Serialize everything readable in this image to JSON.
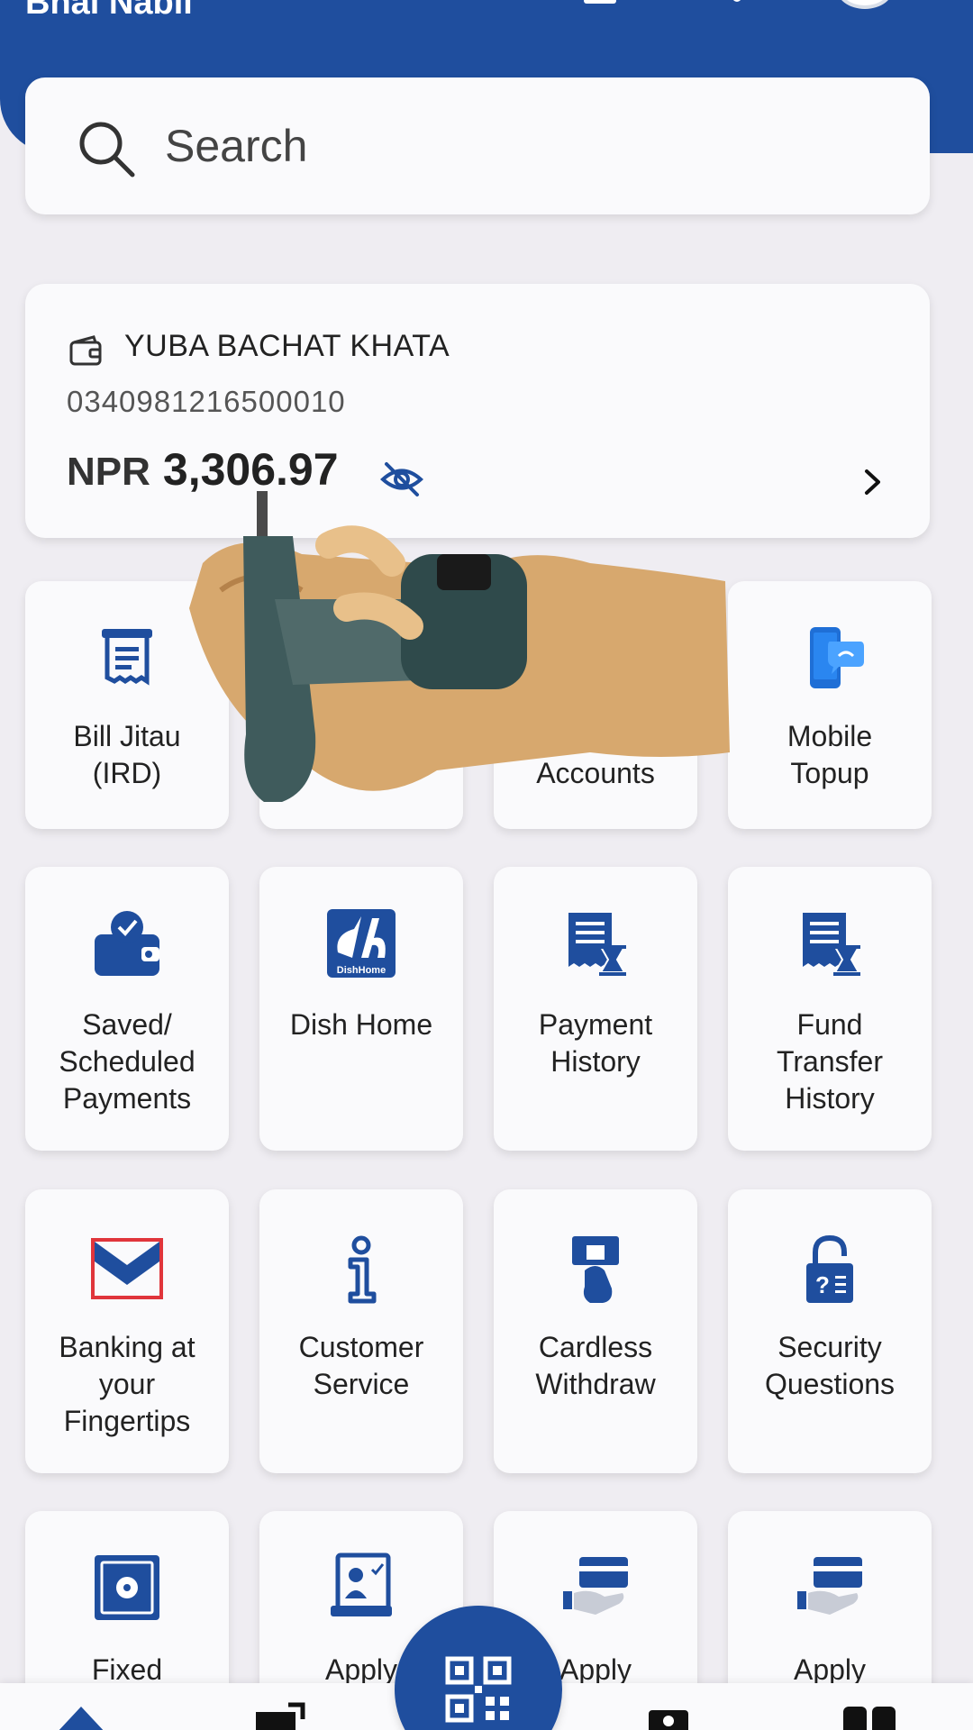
{
  "header": {
    "title": "Bhai Nabil"
  },
  "search": {
    "placeholder": "Search"
  },
  "account": {
    "name": "YUBA BACHAT KHATA",
    "number": "0340981216500010",
    "currency": "NPR",
    "balance": "3,306.97"
  },
  "tiles": {
    "row1": [
      {
        "label": "Bill Jitau\n(IRD)",
        "icon": "bill-receipt-icon"
      },
      {
        "label": "",
        "icon": "hidden-icon"
      },
      {
        "label": "Accounts",
        "icon": "accounts-icon"
      },
      {
        "label": "Mobile\nTopup",
        "icon": "mobile-topup-icon"
      }
    ],
    "row2": [
      {
        "label": "Saved/\nScheduled\nPayments",
        "icon": "saved-payments-icon"
      },
      {
        "label": "Dish Home",
        "icon": "dishhome-logo-icon",
        "logo_text": "DishHome"
      },
      {
        "label": "Payment\nHistory",
        "icon": "payment-history-icon"
      },
      {
        "label": "Fund\nTransfer\nHistory",
        "icon": "fund-transfer-history-icon"
      }
    ],
    "row3": [
      {
        "label": "Banking at\nyour\nFingertips",
        "icon": "banking-fingertips-icon"
      },
      {
        "label": "Customer\nService",
        "icon": "info-icon"
      },
      {
        "label": "Cardless\nWithdraw",
        "icon": "cardless-withdraw-icon"
      },
      {
        "label": "Security\nQuestions",
        "icon": "security-lock-icon"
      }
    ],
    "row4": [
      {
        "label": "Fixed",
        "icon": "fixed-deposit-icon"
      },
      {
        "label": "Apply",
        "icon": "apply-form-icon"
      },
      {
        "label": "Apply",
        "icon": "apply-card-icon"
      },
      {
        "label": "Apply",
        "icon": "apply-card-icon"
      }
    ]
  },
  "bottom_nav": {
    "items": [
      "home-icon",
      "transfer-icon",
      "pay-icon",
      "menu-icon"
    ],
    "center": "qr-scan-icon"
  },
  "colors": {
    "brand": "#1f4e9e",
    "accent_red": "#e0353b",
    "background": "#efedf2",
    "card": "#fafafc"
  }
}
